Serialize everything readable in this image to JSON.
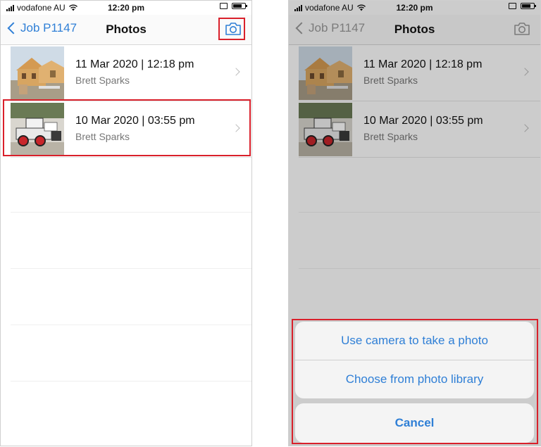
{
  "status_bar": {
    "carrier": "vodafone AU",
    "time": "12:20 pm"
  },
  "nav": {
    "back_label": "Job P1147",
    "title": "Photos"
  },
  "photos": [
    {
      "date": "11 Mar 2020 | 12:18 pm",
      "author": "Brett Sparks"
    },
    {
      "date": "10 Mar 2020 | 03:55 pm",
      "author": "Brett Sparks"
    }
  ],
  "action_sheet": {
    "options": [
      "Use camera to take a photo",
      "Choose from photo library"
    ],
    "cancel": "Cancel"
  },
  "colors": {
    "accent": "#2f7fd6",
    "highlight": "#d9202b",
    "disabled": "#9a9a9a"
  }
}
